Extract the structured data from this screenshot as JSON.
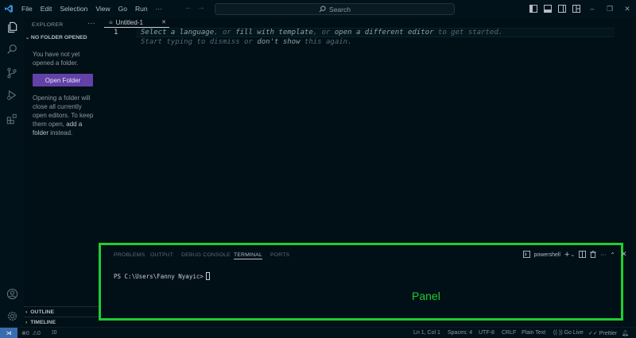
{
  "menu": [
    "File",
    "Edit",
    "Selection",
    "View",
    "Go",
    "Run",
    "···"
  ],
  "search": {
    "placeholder": "Search"
  },
  "explorer": {
    "header": "EXPLORER",
    "more": "···",
    "section": "NO FOLDER OPENED",
    "no_folder_line1": "You have not yet",
    "no_folder_line2": "opened a folder.",
    "open_folder_button": "Open Folder",
    "info_line1": "Opening a folder will",
    "info_line2": "close all currently",
    "info_line3": "open editors. To keep",
    "info_line4_text": "them open, ",
    "info_link1": "add a",
    "info_link2": "folder",
    "info_line5_text": " instead."
  },
  "outline": "OUTLINE",
  "timeline": "TIMELINE",
  "editor": {
    "tab_label": "Untitled-1",
    "line_number": "1",
    "hint1_a": "Select a language",
    "hint1_b": ", or ",
    "hint1_c": "fill with template",
    "hint1_d": ", or ",
    "hint1_e": "open a different editor",
    "hint1_f": " to get started.",
    "hint2_a": "Start typing to dismiss or ",
    "hint2_b": "don't show",
    "hint2_c": " this again."
  },
  "panel": {
    "tabs": [
      "PROBLEMS",
      "OUTPUT",
      "DEBUG CONSOLE",
      "TERMINAL",
      "PORTS"
    ],
    "active_tab": "TERMINAL",
    "shell": "powershell",
    "prompt": "PS C:\\Users\\Fanny Nyayic>",
    "label": "Panel"
  },
  "status": {
    "errors": "0",
    "warnings": "0",
    "ports": "0",
    "position": "Ln 1, Col 1",
    "spaces": "Spaces: 4",
    "encoding": "UTF-8",
    "eol": "CRLF",
    "language": "Plain Text",
    "go_live": "Go Live",
    "prettier": "Prettier"
  },
  "colors": {
    "accent": "#6241a8",
    "annotation": "#1fcd33",
    "remote": "#3a6db0"
  }
}
